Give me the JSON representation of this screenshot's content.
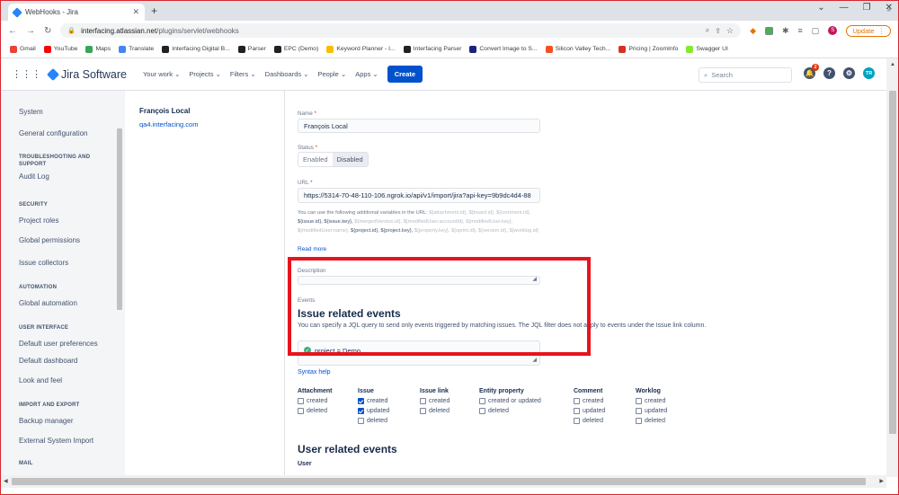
{
  "browser": {
    "tab_title": "WebHooks - Jira",
    "url_host": "interfacing.atlassian.net",
    "url_path": "/plugins/servlet/webhooks",
    "update_label": "Update",
    "profile_letter": "S",
    "bookmarks": [
      {
        "label": "Gmail",
        "color": "#ea4335"
      },
      {
        "label": "YouTube",
        "color": "#ff0000"
      },
      {
        "label": "Maps",
        "color": "#34a853"
      },
      {
        "label": "Translate",
        "color": "#4285f4"
      },
      {
        "label": "Interfacing Digital B...",
        "color": "#202124"
      },
      {
        "label": "Parser",
        "color": "#202124"
      },
      {
        "label": "EPC (Demo)",
        "color": "#202124"
      },
      {
        "label": "Keyword Planner - I...",
        "color": "#fbbc04"
      },
      {
        "label": "Interfacing Parser",
        "color": "#202124"
      },
      {
        "label": "Convert Image to S...",
        "color": "#1a237e"
      },
      {
        "label": "Silicon Valley Tech...",
        "color": "#f4511e"
      },
      {
        "label": "Pricing | ZoomInfo",
        "color": "#d93025"
      },
      {
        "label": "Swagger UI",
        "color": "#85ea2d"
      }
    ]
  },
  "jira": {
    "product": "Jira Software",
    "nav": [
      "Your work",
      "Projects",
      "Filters",
      "Dashboards",
      "People",
      "Apps"
    ],
    "create": "Create",
    "search_placeholder": "Search",
    "notifications_count": "2",
    "user_initials": "TR"
  },
  "sidebar": {
    "items": [
      {
        "type": "item",
        "label": "System"
      },
      {
        "type": "item",
        "label": "General configuration"
      },
      {
        "type": "head",
        "label": "TROUBLESHOOTING AND SUPPORT"
      },
      {
        "type": "item",
        "label": "Audit Log"
      },
      {
        "type": "head",
        "label": "SECURITY"
      },
      {
        "type": "item",
        "label": "Project roles"
      },
      {
        "type": "item",
        "label": "Global permissions"
      },
      {
        "type": "item",
        "label": "Issue collectors"
      },
      {
        "type": "head",
        "label": "AUTOMATION"
      },
      {
        "type": "item",
        "label": "Global automation"
      },
      {
        "type": "head",
        "label": "USER INTERFACE"
      },
      {
        "type": "item",
        "label": "Default user preferences"
      },
      {
        "type": "item",
        "label": "Default dashboard"
      },
      {
        "type": "item",
        "label": "Look and feel"
      },
      {
        "type": "head",
        "label": "IMPORT AND EXPORT"
      },
      {
        "type": "item",
        "label": "Backup manager"
      },
      {
        "type": "item",
        "label": "External System Import"
      },
      {
        "type": "head",
        "label": "MAIL"
      }
    ]
  },
  "webhook": {
    "name": "François Local",
    "host": "qa4.interfacing.com"
  },
  "form": {
    "name_label": "Name",
    "name_value": "François Local",
    "status_label": "Status",
    "status_enabled": "Enabled",
    "status_disabled": "Disabled",
    "url_label": "URL",
    "url_value": "https://5314-70-48-110-106.ngrok.io/api/v1/import/jira?api-key=9b9dc4d4-88",
    "help_intro": "You can use the following additional variables in the URL:",
    "help_vars_muted_1": "${attachment.id}, ${board.id}, ${comment.id},",
    "help_vars_dark_1": "${issue.id}, ${issue.key},",
    "help_vars_muted_2": "${mergedVersion.id}, ${modifiedUser.accountId}, ${modifiedUser.key}, ${modifiedUser.name},",
    "help_vars_dark_2": "${project.id}, ${project.key},",
    "help_vars_muted_3": "${property.key}, ${sprint.id}, ${version.id}, ${worklog.id}",
    "read_more": "Read more",
    "description_label": "Description",
    "events_label": "Events",
    "issue_events_title": "Issue related events",
    "jql_desc": "You can specify a JQL query to send only events triggered by matching issues. The JQL filter does not apply to events under the Issue link column.",
    "jql_value": "project = Demo",
    "syntax_help": "Syntax help",
    "user_events_title": "User related events",
    "user_label": "User"
  },
  "events": [
    {
      "head": "Attachment",
      "opts": [
        {
          "label": "created",
          "on": false
        },
        {
          "label": "deleted",
          "on": false
        }
      ]
    },
    {
      "head": "Issue",
      "opts": [
        {
          "label": "created",
          "on": true
        },
        {
          "label": "updated",
          "on": true
        },
        {
          "label": "deleted",
          "on": false
        }
      ]
    },
    {
      "head": "Issue link",
      "opts": [
        {
          "label": "created",
          "on": false
        },
        {
          "label": "deleted",
          "on": false
        }
      ]
    },
    {
      "head": "Entity property",
      "opts": [
        {
          "label": "created or updated",
          "on": false
        },
        {
          "label": "deleted",
          "on": false
        }
      ]
    },
    {
      "head": "Comment",
      "opts": [
        {
          "label": "created",
          "on": false
        },
        {
          "label": "updated",
          "on": false
        },
        {
          "label": "deleted",
          "on": false
        }
      ]
    },
    {
      "head": "Worklog",
      "opts": [
        {
          "label": "created",
          "on": false
        },
        {
          "label": "updated",
          "on": false
        },
        {
          "label": "deleted",
          "on": false
        }
      ]
    }
  ],
  "colors": {
    "accent": "#0052cc",
    "highlight": "#e6141d",
    "success": "#36b37e"
  }
}
